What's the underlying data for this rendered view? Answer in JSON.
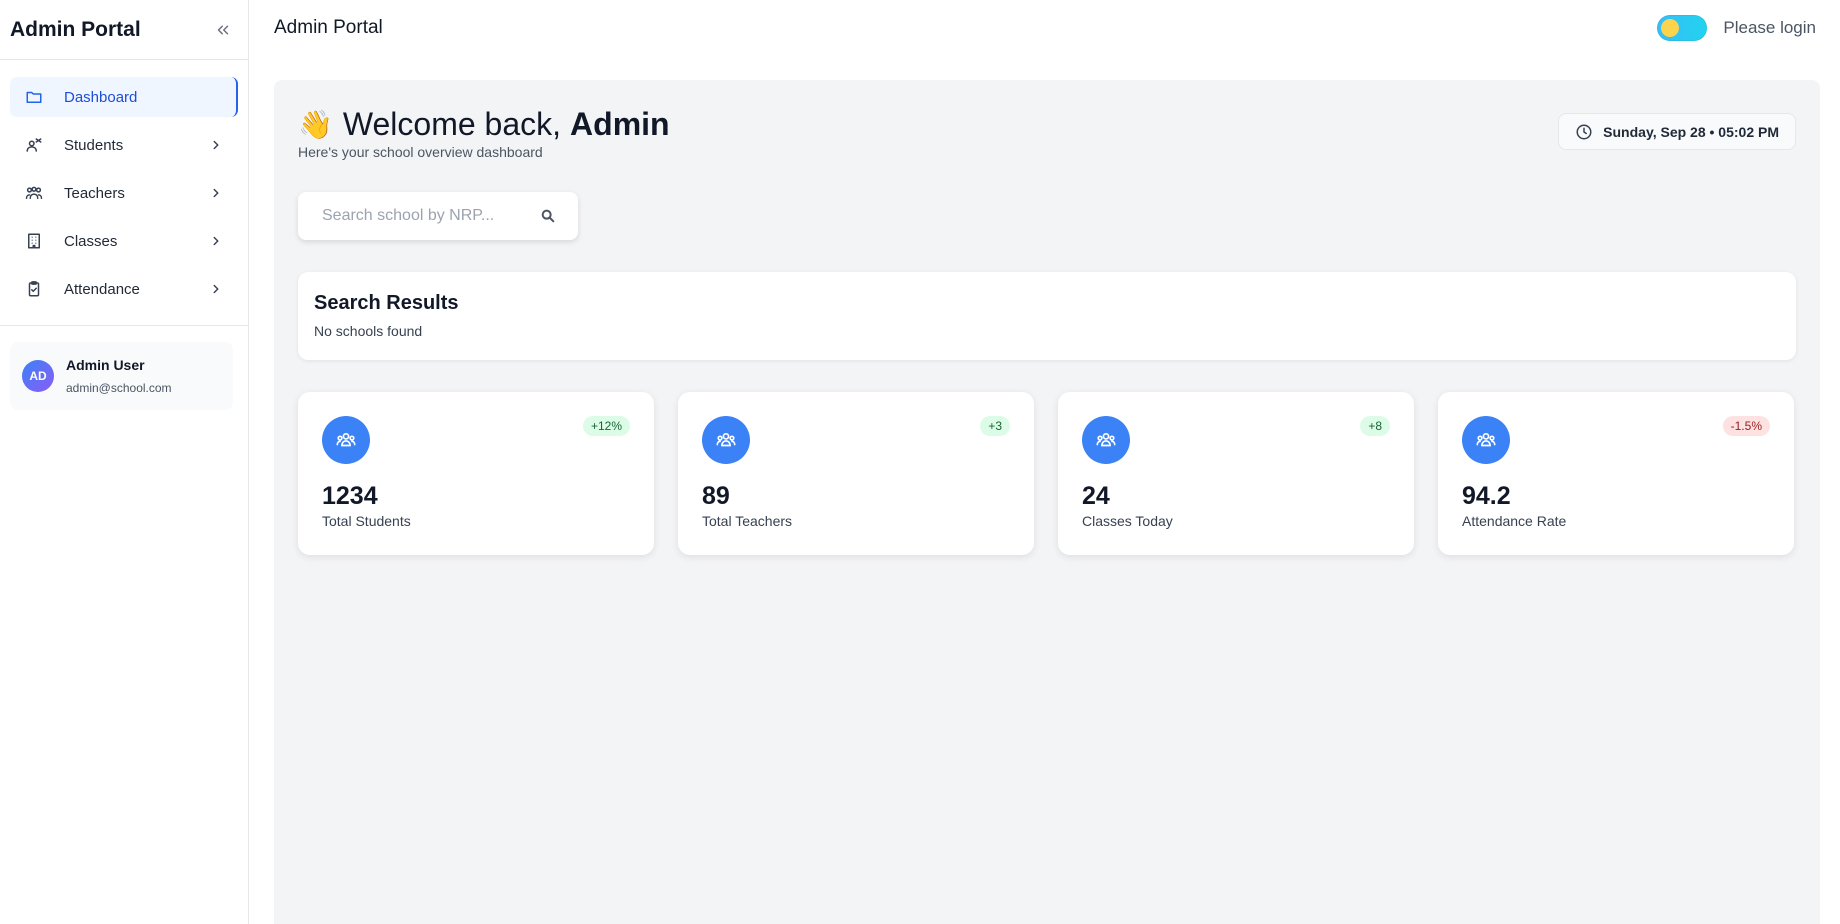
{
  "sidebar": {
    "title": "Admin Portal",
    "items": [
      {
        "label": "Dashboard",
        "icon": "folder-icon"
      },
      {
        "label": "Students",
        "icon": "students-icon"
      },
      {
        "label": "Teachers",
        "icon": "teachers-icon"
      },
      {
        "label": "Classes",
        "icon": "building-icon"
      },
      {
        "label": "Attendance",
        "icon": "clipboard-icon"
      }
    ],
    "user": {
      "initials": "AD",
      "name": "Admin User",
      "email": "admin@school.com"
    }
  },
  "topbar": {
    "title": "Admin Portal",
    "login_text": "Please login"
  },
  "welcome": {
    "emoji": "👋",
    "greeting": "Welcome back,",
    "name": "Admin",
    "subtitle": "Here's your school overview dashboard",
    "date": "Sunday, Sep 28 • 05:02 PM"
  },
  "search": {
    "placeholder": "Search school by NRP..."
  },
  "results": {
    "title": "Search Results",
    "empty_text": "No schools found"
  },
  "stats": [
    {
      "value": "1234",
      "label": "Total Students",
      "badge": "+12%",
      "trend": "positive"
    },
    {
      "value": "89",
      "label": "Total Teachers",
      "badge": "+3",
      "trend": "positive"
    },
    {
      "value": "24",
      "label": "Classes Today",
      "badge": "+8",
      "trend": "positive"
    },
    {
      "value": "94.2",
      "label": "Attendance Rate",
      "badge": "-1.5%",
      "trend": "negative"
    }
  ],
  "colors": {
    "accent": "#3b82f6",
    "active_nav": "#2563eb",
    "positive_bg": "#dcfce7",
    "negative_bg": "#fee2e2"
  }
}
